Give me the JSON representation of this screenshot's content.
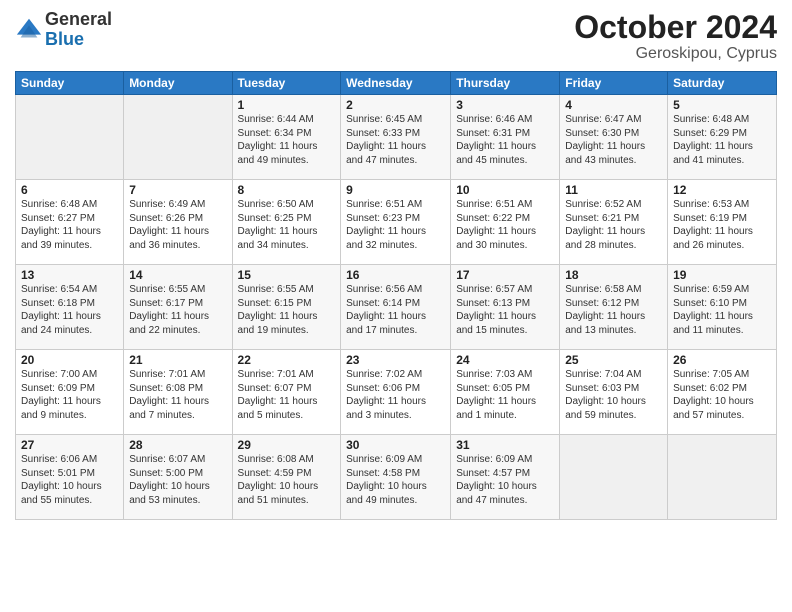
{
  "header": {
    "logo_general": "General",
    "logo_blue": "Blue",
    "month_title": "October 2024",
    "subtitle": "Geroskipou, Cyprus"
  },
  "days_of_week": [
    "Sunday",
    "Monday",
    "Tuesday",
    "Wednesday",
    "Thursday",
    "Friday",
    "Saturday"
  ],
  "weeks": [
    [
      {
        "day": "",
        "sunrise": "",
        "sunset": "",
        "daylight": ""
      },
      {
        "day": "",
        "sunrise": "",
        "sunset": "",
        "daylight": ""
      },
      {
        "day": "1",
        "sunrise": "Sunrise: 6:44 AM",
        "sunset": "Sunset: 6:34 PM",
        "daylight": "Daylight: 11 hours and 49 minutes."
      },
      {
        "day": "2",
        "sunrise": "Sunrise: 6:45 AM",
        "sunset": "Sunset: 6:33 PM",
        "daylight": "Daylight: 11 hours and 47 minutes."
      },
      {
        "day": "3",
        "sunrise": "Sunrise: 6:46 AM",
        "sunset": "Sunset: 6:31 PM",
        "daylight": "Daylight: 11 hours and 45 minutes."
      },
      {
        "day": "4",
        "sunrise": "Sunrise: 6:47 AM",
        "sunset": "Sunset: 6:30 PM",
        "daylight": "Daylight: 11 hours and 43 minutes."
      },
      {
        "day": "5",
        "sunrise": "Sunrise: 6:48 AM",
        "sunset": "Sunset: 6:29 PM",
        "daylight": "Daylight: 11 hours and 41 minutes."
      }
    ],
    [
      {
        "day": "6",
        "sunrise": "Sunrise: 6:48 AM",
        "sunset": "Sunset: 6:27 PM",
        "daylight": "Daylight: 11 hours and 39 minutes."
      },
      {
        "day": "7",
        "sunrise": "Sunrise: 6:49 AM",
        "sunset": "Sunset: 6:26 PM",
        "daylight": "Daylight: 11 hours and 36 minutes."
      },
      {
        "day": "8",
        "sunrise": "Sunrise: 6:50 AM",
        "sunset": "Sunset: 6:25 PM",
        "daylight": "Daylight: 11 hours and 34 minutes."
      },
      {
        "day": "9",
        "sunrise": "Sunrise: 6:51 AM",
        "sunset": "Sunset: 6:23 PM",
        "daylight": "Daylight: 11 hours and 32 minutes."
      },
      {
        "day": "10",
        "sunrise": "Sunrise: 6:51 AM",
        "sunset": "Sunset: 6:22 PM",
        "daylight": "Daylight: 11 hours and 30 minutes."
      },
      {
        "day": "11",
        "sunrise": "Sunrise: 6:52 AM",
        "sunset": "Sunset: 6:21 PM",
        "daylight": "Daylight: 11 hours and 28 minutes."
      },
      {
        "day": "12",
        "sunrise": "Sunrise: 6:53 AM",
        "sunset": "Sunset: 6:19 PM",
        "daylight": "Daylight: 11 hours and 26 minutes."
      }
    ],
    [
      {
        "day": "13",
        "sunrise": "Sunrise: 6:54 AM",
        "sunset": "Sunset: 6:18 PM",
        "daylight": "Daylight: 11 hours and 24 minutes."
      },
      {
        "day": "14",
        "sunrise": "Sunrise: 6:55 AM",
        "sunset": "Sunset: 6:17 PM",
        "daylight": "Daylight: 11 hours and 22 minutes."
      },
      {
        "day": "15",
        "sunrise": "Sunrise: 6:55 AM",
        "sunset": "Sunset: 6:15 PM",
        "daylight": "Daylight: 11 hours and 19 minutes."
      },
      {
        "day": "16",
        "sunrise": "Sunrise: 6:56 AM",
        "sunset": "Sunset: 6:14 PM",
        "daylight": "Daylight: 11 hours and 17 minutes."
      },
      {
        "day": "17",
        "sunrise": "Sunrise: 6:57 AM",
        "sunset": "Sunset: 6:13 PM",
        "daylight": "Daylight: 11 hours and 15 minutes."
      },
      {
        "day": "18",
        "sunrise": "Sunrise: 6:58 AM",
        "sunset": "Sunset: 6:12 PM",
        "daylight": "Daylight: 11 hours and 13 minutes."
      },
      {
        "day": "19",
        "sunrise": "Sunrise: 6:59 AM",
        "sunset": "Sunset: 6:10 PM",
        "daylight": "Daylight: 11 hours and 11 minutes."
      }
    ],
    [
      {
        "day": "20",
        "sunrise": "Sunrise: 7:00 AM",
        "sunset": "Sunset: 6:09 PM",
        "daylight": "Daylight: 11 hours and 9 minutes."
      },
      {
        "day": "21",
        "sunrise": "Sunrise: 7:01 AM",
        "sunset": "Sunset: 6:08 PM",
        "daylight": "Daylight: 11 hours and 7 minutes."
      },
      {
        "day": "22",
        "sunrise": "Sunrise: 7:01 AM",
        "sunset": "Sunset: 6:07 PM",
        "daylight": "Daylight: 11 hours and 5 minutes."
      },
      {
        "day": "23",
        "sunrise": "Sunrise: 7:02 AM",
        "sunset": "Sunset: 6:06 PM",
        "daylight": "Daylight: 11 hours and 3 minutes."
      },
      {
        "day": "24",
        "sunrise": "Sunrise: 7:03 AM",
        "sunset": "Sunset: 6:05 PM",
        "daylight": "Daylight: 11 hours and 1 minute."
      },
      {
        "day": "25",
        "sunrise": "Sunrise: 7:04 AM",
        "sunset": "Sunset: 6:03 PM",
        "daylight": "Daylight: 10 hours and 59 minutes."
      },
      {
        "day": "26",
        "sunrise": "Sunrise: 7:05 AM",
        "sunset": "Sunset: 6:02 PM",
        "daylight": "Daylight: 10 hours and 57 minutes."
      }
    ],
    [
      {
        "day": "27",
        "sunrise": "Sunrise: 6:06 AM",
        "sunset": "Sunset: 5:01 PM",
        "daylight": "Daylight: 10 hours and 55 minutes."
      },
      {
        "day": "28",
        "sunrise": "Sunrise: 6:07 AM",
        "sunset": "Sunset: 5:00 PM",
        "daylight": "Daylight: 10 hours and 53 minutes."
      },
      {
        "day": "29",
        "sunrise": "Sunrise: 6:08 AM",
        "sunset": "Sunset: 4:59 PM",
        "daylight": "Daylight: 10 hours and 51 minutes."
      },
      {
        "day": "30",
        "sunrise": "Sunrise: 6:09 AM",
        "sunset": "Sunset: 4:58 PM",
        "daylight": "Daylight: 10 hours and 49 minutes."
      },
      {
        "day": "31",
        "sunrise": "Sunrise: 6:09 AM",
        "sunset": "Sunset: 4:57 PM",
        "daylight": "Daylight: 10 hours and 47 minutes."
      },
      {
        "day": "",
        "sunrise": "",
        "sunset": "",
        "daylight": ""
      },
      {
        "day": "",
        "sunrise": "",
        "sunset": "",
        "daylight": ""
      }
    ]
  ]
}
